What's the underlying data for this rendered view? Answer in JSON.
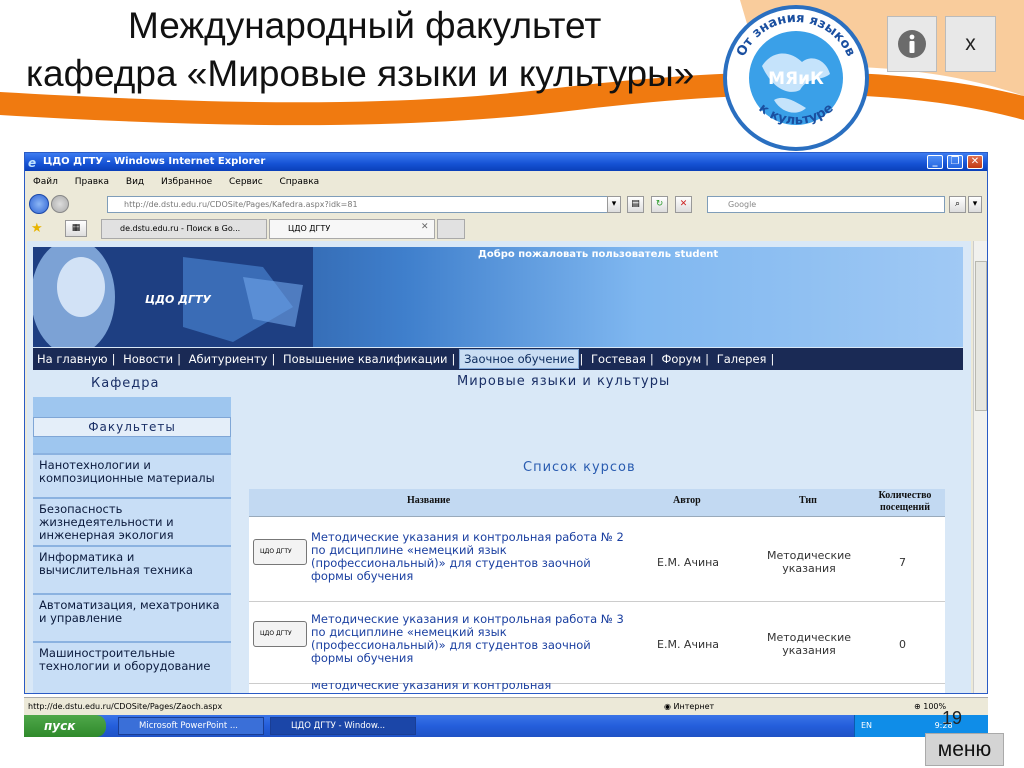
{
  "slide": {
    "title_line1": "Международный факультет",
    "title_line2": "кафедра «Мировые языки и культуры»",
    "logo_text_top": "От знания языков",
    "logo_text_bottom": "к культуре",
    "logo_center": "МЯиК",
    "close_label": "x",
    "slide_number": "19",
    "menu_label": "меню"
  },
  "browser": {
    "title": "ЦДО ДГТУ - Windows Internet Explorer",
    "menu": [
      "Файл",
      "Правка",
      "Вид",
      "Избранное",
      "Сервис",
      "Справка"
    ],
    "url": "http://de.dstu.edu.ru/CDOSite/Pages/Kafedra.aspx?idk=81",
    "search_placeholder": "Google",
    "tabs": [
      "de.dstu.edu.ru - Поиск в Go...",
      "ЦДО ДГТУ"
    ],
    "status_url": "http://de.dstu.edu.ru/CDOSite/Pages/Zaoch.aspx",
    "status_zone": "Интернет",
    "status_zoom": "100%"
  },
  "site": {
    "banner_logo": "ЦДО ДГТУ",
    "welcome": "Добро пожаловать пользователь student",
    "nav": [
      "На главную",
      "Новости",
      "Абитуриенту",
      "Повышение квалификации",
      "Заочное обучение",
      "Гостевая",
      "Форум",
      "Галерея"
    ],
    "active_nav": "Заочное обучение",
    "left_heading": "Кафедра",
    "page_title": "Мировые языки и культуры",
    "faculties_header": "Факультеты",
    "faculties": [
      "Нанотехнологии и композиционные материалы",
      "Безопасность жизнедеятельности и инженерная экология",
      "Информатика и вычислительная техника",
      "Автоматизация, мехатроника и управление",
      "Машиностроительные технологии и оборудование"
    ],
    "course_list_title": "Список курсов",
    "table_headers": {
      "name": "Название",
      "author": "Автор",
      "type": "Тип",
      "visits": "Количество посещений"
    },
    "icon_label": "ЦДО ДГТУ",
    "courses": [
      {
        "name": "Методические указания и контрольная работа № 2 по дисциплине «немецкий язык (профессиональный)» для студентов заочной формы обучения",
        "author": "Е.М. Ачина",
        "type": "Методические указания",
        "visits": "7"
      },
      {
        "name": "Методические указания и контрольная работа № 3 по дисциплине «немецкий язык (профессиональный)» для студентов заочной формы обучения",
        "author": "Е.М. Ачина",
        "type": "Методические указания",
        "visits": "0"
      },
      {
        "name": "Методические указания и контрольная",
        "author": "",
        "type": "",
        "visits": ""
      }
    ]
  },
  "taskbar": {
    "start": "пуск",
    "items": [
      "Microsoft PowerPoint ...",
      "ЦДО ДГТУ - Window..."
    ],
    "lang": "EN",
    "clock": "9:28"
  },
  "colors": {
    "accent_orange": "#f07a10",
    "ie_blue": "#1552d4",
    "site_nav": "#1a2a55",
    "link_blue": "#1a3fa0"
  }
}
